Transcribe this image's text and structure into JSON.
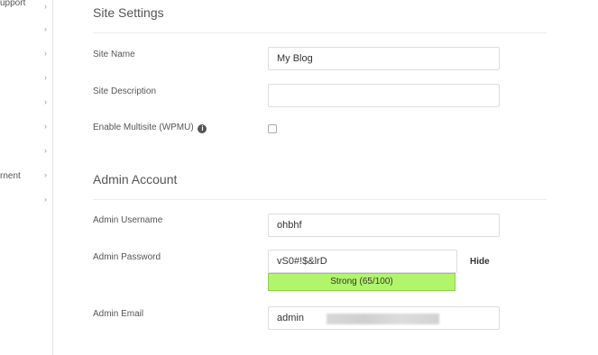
{
  "sidebar": {
    "items": [
      {
        "label": "upport"
      },
      {
        "label": ""
      },
      {
        "label": ""
      },
      {
        "label": ""
      },
      {
        "label": ""
      },
      {
        "label": ""
      },
      {
        "label": ""
      },
      {
        "label": "rnent"
      },
      {
        "label": ""
      }
    ],
    "chevron": "›"
  },
  "site_settings": {
    "title": "Site Settings",
    "site_name_label": "Site Name",
    "site_name_value": "My Blog",
    "site_description_label": "Site Description",
    "site_description_value": "",
    "multisite_label": "Enable Multisite (WPMU)",
    "multisite_info_icon": "info-icon",
    "multisite_checked": false
  },
  "admin_account": {
    "title": "Admin Account",
    "username_label": "Admin Username",
    "username_value": "ohbhf",
    "password_label": "Admin Password",
    "password_value": "vS0#!$&lrD",
    "hide_label": "Hide",
    "strength_label": "Strong (65/100)",
    "strength_score": 65,
    "strength_color": "#b1f56b",
    "email_label": "Admin Email",
    "email_value": "admin"
  }
}
